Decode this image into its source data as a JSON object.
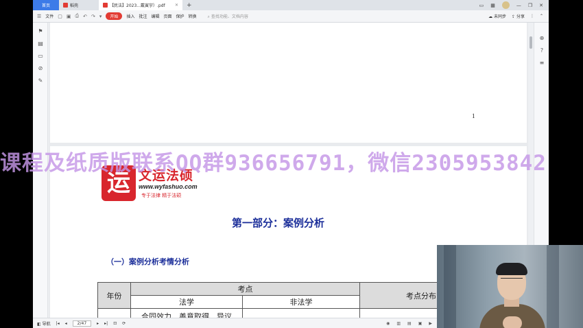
{
  "tabs": {
    "home": "首页",
    "daoke": "稻壳",
    "pdf": "【民法】2023...戴寅宇）.pdf"
  },
  "toolbar": {
    "file": "文件",
    "start": "开始",
    "insert": "插入",
    "comment": "批注",
    "edit": "编辑",
    "page": "页面",
    "protect": "保护",
    "convert": "转换",
    "search_placeholder": "查找功能、文档内容",
    "unsync": "未同步",
    "share": "分享"
  },
  "document": {
    "page1_number": "1",
    "brand_cn": "文运法硕",
    "brand_mark": "运",
    "brand_url": "www.wyfashuo.com",
    "brand_slogan": "专于法律  精于法硕",
    "heading1": "第一部分：案例分析",
    "heading2": "（一）案例分析考情分析",
    "table": {
      "col_year": "年份",
      "col_kaodian": "考点",
      "col_faxue": "法学",
      "col_feifaxue": "非法学",
      "col_distribution": "考点分布",
      "row1_faxue": "合同效力、善意取得、异议"
    }
  },
  "watermark": "课程及纸质版联系QQ群936656791，微信2305953842",
  "statusbar": {
    "nav": "导航",
    "page_indicator": "2/47"
  }
}
